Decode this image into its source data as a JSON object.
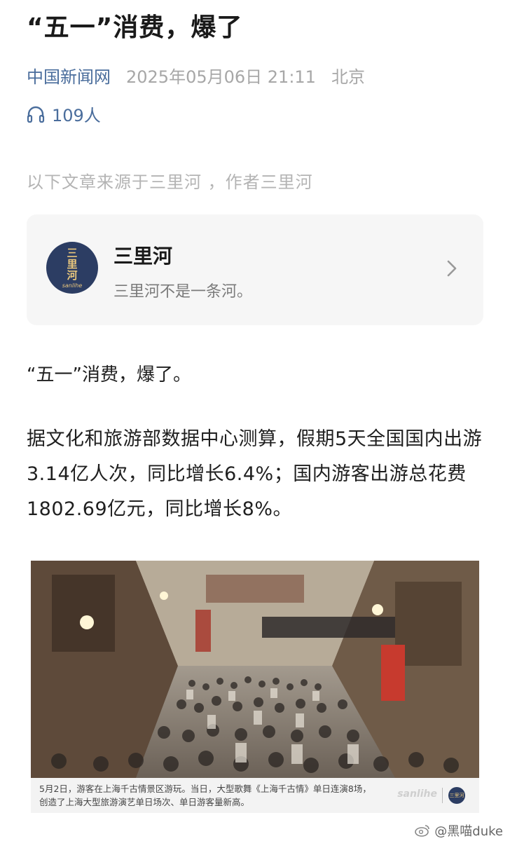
{
  "article": {
    "title": "“五一”消费，爆了",
    "source": "中国新闻网",
    "datetime": "2025年05月06日 21:11",
    "location": "北京",
    "listen_count": "109人",
    "attribution": "以下文章来源于三里河 ，作者三里河"
  },
  "account": {
    "name": "三里河",
    "description": "三里河不是一条河。",
    "avatar_text": "三里河",
    "avatar_sub": "sanlihe"
  },
  "body": {
    "p1": "“五一”消费，爆了。",
    "p2": "据文化和旅游部数据中心测算，假期5天全国国内出游3.14亿人次，同比增长6.4%；国内游客出游总花费1802.69亿元，同比增长8%。"
  },
  "photo": {
    "caption": "5月2日，游客在上海千古情景区游玩。当日，大型歌舞《上海千古情》单日连演8场，创造了上海大型旅游演艺单日场次、单日游客量新高。",
    "logo_text": "sanlihe",
    "badge_text": "三里河"
  },
  "watermark": {
    "text": "@黑喵duke"
  },
  "icons": [
    "headphones-icon",
    "chevron-right-icon",
    "weibo-icon"
  ],
  "colors": {
    "link": "#4a6d9c",
    "avatar_bg": "#2c3d63",
    "avatar_fg": "#e8c67d"
  }
}
